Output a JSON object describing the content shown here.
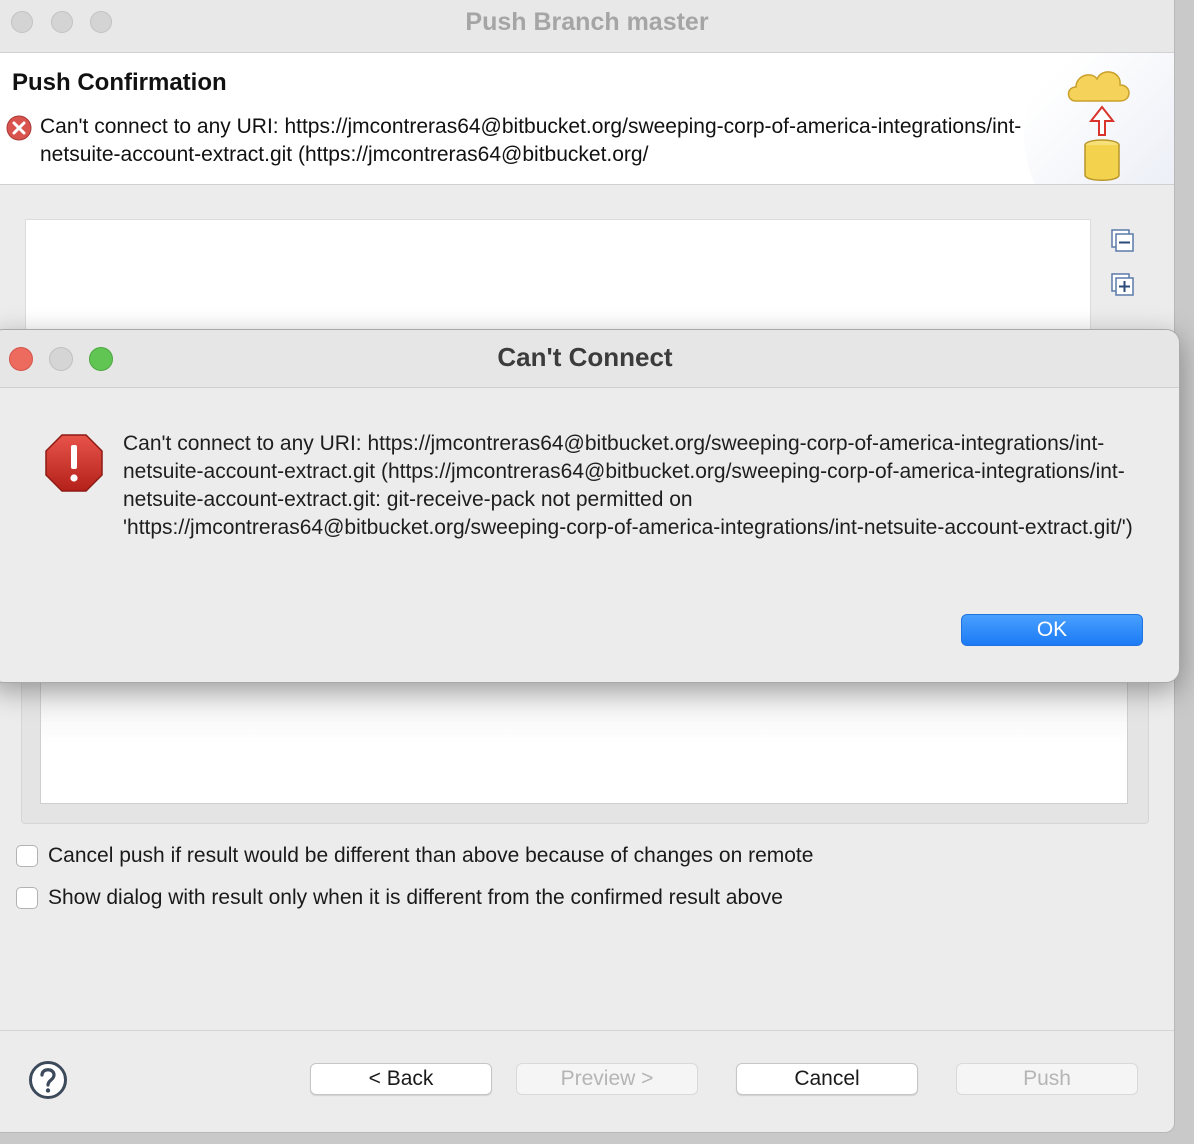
{
  "window": {
    "title": "Push Branch master",
    "header": {
      "title": "Push Confirmation",
      "message": "Can't connect to any URI: https://jmcontreras64@bitbucket.org/sweeping-corp-of-america-integrations/int-netsuite-account-extract.git (https://jmcontreras64@bitbucket.org/"
    },
    "options": {
      "cancel_push_label": "Cancel push if result would be different than above because of changes on remote",
      "show_dialog_label": "Show dialog with result only when it is different from the confirmed result above"
    },
    "buttons": {
      "back": "< Back",
      "preview": "Preview >",
      "cancel": "Cancel",
      "push": "Push"
    }
  },
  "dialog": {
    "title": "Can't Connect",
    "message": "Can't connect to any URI: https://jmcontreras64@bitbucket.org/sweeping-corp-of-america-integrations/int-netsuite-account-extract.git (https://jmcontreras64@bitbucket.org/sweeping-corp-of-america-integrations/int-netsuite-account-extract.git: git-receive-pack not permitted on 'https://jmcontreras64@bitbucket.org/sweeping-corp-of-america-integrations/int-netsuite-account-extract.git/')",
    "ok_label": "OK"
  },
  "icons": {
    "error": "error-icon",
    "stop": "stop-alert-icon",
    "collapse_all": "collapse-all-icon",
    "expand_all": "expand-all-icon",
    "help": "help-icon",
    "wizard": "cloud-push-icon"
  },
  "colors": {
    "accent": "#1b7af5",
    "close_light": "#ed6a5e",
    "minimize_light": "#d5d5d5",
    "zoom_light": "#61c554",
    "error": "#c0302a"
  }
}
